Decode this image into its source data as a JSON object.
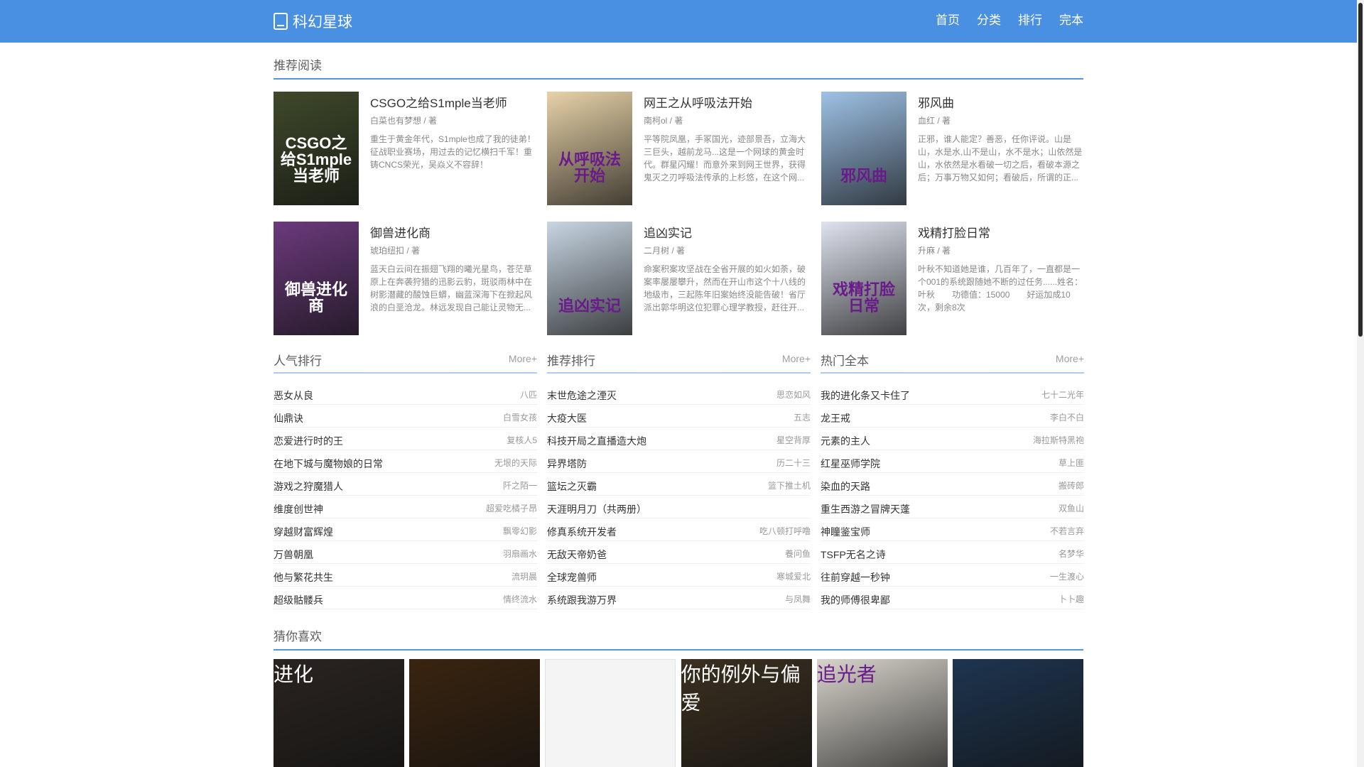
{
  "header": {
    "logo_text": "科幻星球",
    "nav": [
      "首页",
      "分类",
      "排行",
      "完本"
    ]
  },
  "recommend": {
    "title": "推荐阅读",
    "books": [
      {
        "title": "CSGO之给S1mple当老师",
        "author": "白菜也有梦想 / 著",
        "desc": "重生于黄金年代，S1mple也成了我的徒弟！征战职业赛场，用过去的记忆横扫千军！重铸CNCS荣光，吴焱义不容辞！",
        "cover_text": "CSGO之给S1mple当老师",
        "cover_bg": "#3e4a2a"
      },
      {
        "title": "网王之从呼吸法开始",
        "author": "南柯ol / 著",
        "desc": "平等院凤凰，手冢国光，迹部景吾，立海大三巨头，越前龙马...这是一个网球的黄金时代。群星闪耀！而意外来到网王世界，获得鬼灭之刃呼吸法传承的上杉悠，在这个网...",
        "cover_text": "从呼吸法开始",
        "cover_bg": "#e8d3a8"
      },
      {
        "title": "邪风曲",
        "author": "血红 / 著",
        "desc": "正邪，谁人能定？善恶，任你评说。山是山，水是水,山不是山，水不是水；山依然是山，水依然是水看破一切之后，看破本源之后；万事万物又如何；看破后，所谓的正...",
        "cover_text": "邪风曲",
        "cover_bg": "#9ec2e6"
      },
      {
        "title": "御兽进化商",
        "author": "琥珀纽扣 / 著",
        "desc": "蓝天白云间在振翅飞翔的曦光星鸟，苍茫草原上在奔袭狩猎的迅影云豹，斑驳雨林中在树影潜藏的酸蚀巨蟒，幽蓝深海下在掀起风浪的白垩沧龙。林远发现自己能让灵物无...",
        "cover_text": "御兽进化商",
        "cover_bg": "#6b3a7d"
      },
      {
        "title": "追凶实记",
        "author": "二月树 / 著",
        "desc": "命案积案攻坚战在全省开展的如火如荼，破案率屡屡攀升，然而在开山市这个十八线的地级市，三起陈年旧案始终没能告破！省厅派出郭华明这位犯罪心理学教授，赶往开...",
        "cover_text": "追凶实记",
        "cover_bg": "#c8d6e2"
      },
      {
        "title": "戏精打脸日常",
        "author": "升麻 / 著",
        "desc": "叶秋不知道她是谁，几百年了，一直都是一个001的系统跟随她不断的过任务......姓名：叶秋　　功德值：15000　　好运加成10次，剩余8次",
        "cover_text": "戏精打脸日常",
        "cover_bg": "#dfe3ee"
      }
    ]
  },
  "rankings": [
    {
      "title": "人气排行",
      "more": "More+",
      "items": [
        {
          "name": "恶女从良",
          "author": "八匹"
        },
        {
          "name": "仙鼎诀",
          "author": "白雪女孩"
        },
        {
          "name": "恋爱进行时的王",
          "author": "复核人5"
        },
        {
          "name": "在地下城与魔物娘的日常",
          "author": "无垠的天际"
        },
        {
          "name": "游戏之狩魔猎人",
          "author": "阡之陌一"
        },
        {
          "name": "维度创世神",
          "author": "超爱吃橘子昂"
        },
        {
          "name": "穿越财富辉煌",
          "author": "飘零幻影"
        },
        {
          "name": "万兽朝凰",
          "author": "羽扇画水"
        },
        {
          "name": "他与繁花共生",
          "author": "流玥晨"
        },
        {
          "name": "超级骷髅兵",
          "author": "情终流水"
        }
      ]
    },
    {
      "title": "推荐排行",
      "more": "More+",
      "items": [
        {
          "name": "末世危途之湮灭",
          "author": "思恋如风"
        },
        {
          "name": "大疫大医",
          "author": "五志"
        },
        {
          "name": "科技开局之直播造大炮",
          "author": "星空背厚"
        },
        {
          "name": "异界塔防",
          "author": "历二十三"
        },
        {
          "name": "篮坛之灭霸",
          "author": "篮下推土机"
        },
        {
          "name": "天涯明月刀（共两册）",
          "author": ""
        },
        {
          "name": "修真系统开发者",
          "author": "吃八顿打呼噜"
        },
        {
          "name": "无敌天帝奶爸",
          "author": "養问鱼"
        },
        {
          "name": "全球宠兽师",
          "author": "寒城爱北"
        },
        {
          "name": "系统跟我游万界",
          "author": "与凤舞"
        }
      ]
    },
    {
      "title": "热门全本",
      "more": "More+",
      "items": [
        {
          "name": "我的进化条又卡住了",
          "author": "七十二光年"
        },
        {
          "name": "龙王戒",
          "author": "李白不白"
        },
        {
          "name": "元素的主人",
          "author": "海拉斯特黑袍"
        },
        {
          "name": "红星巫师学院",
          "author": "草上匪"
        },
        {
          "name": "染血的天路",
          "author": "搬砖郎"
        },
        {
          "name": "重生西游之冒牌天蓬",
          "author": "双鱼山"
        },
        {
          "name": "神瞳鉴宝师",
          "author": "不若言弃"
        },
        {
          "name": "TSFP无名之诗",
          "author": "名梦华"
        },
        {
          "name": "往前穿越一秒钟",
          "author": "一生渡心"
        },
        {
          "name": "我的师傅很卑鄙",
          "author": "卜卜趣"
        }
      ]
    }
  ],
  "guess": {
    "title": "猜你喜欢",
    "covers": [
      {
        "text": "进化",
        "bg": "#2a2420"
      },
      {
        "text": "",
        "bg": "#3a2410"
      },
      {
        "text": "",
        "bg": "#f2f2f2"
      },
      {
        "text": "你的例外与偏爱",
        "bg": "#3b3020"
      },
      {
        "text": "追光者",
        "bg": "#d8d4cc"
      },
      {
        "text": "",
        "bg": "#1e3550"
      }
    ]
  }
}
